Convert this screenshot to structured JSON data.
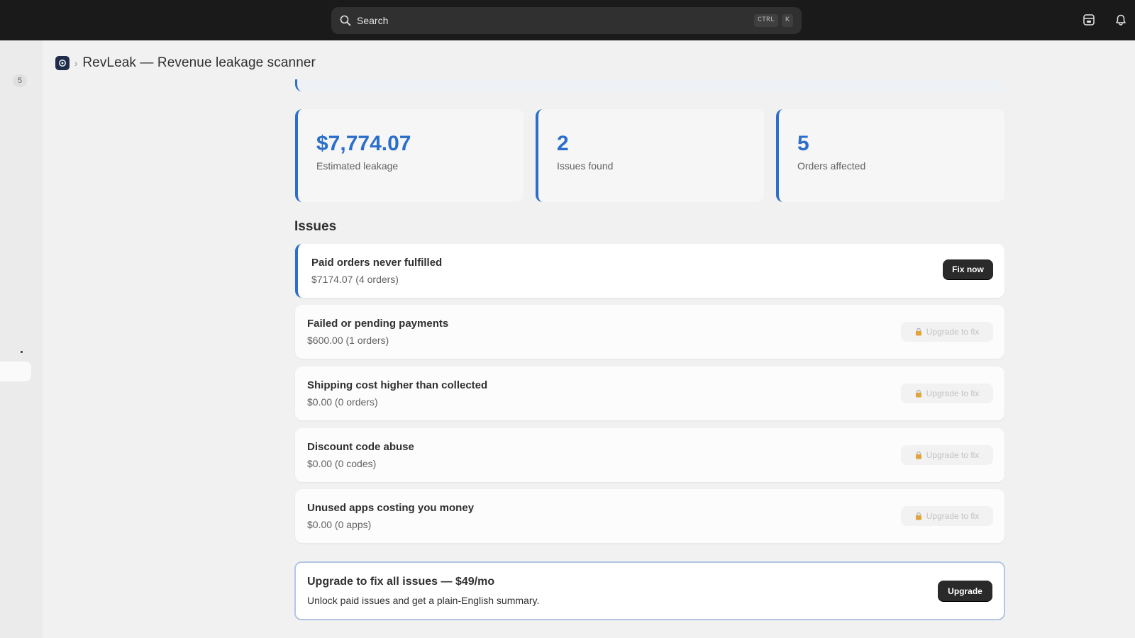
{
  "topbar": {
    "search_label": "Search",
    "shortcut_modifier": "CTRL",
    "shortcut_key": "K"
  },
  "sidebar": {
    "badge": "5"
  },
  "breadcrumb": {
    "app_title": "RevLeak — Revenue leakage scanner"
  },
  "stats": [
    {
      "value": "$7,774.07",
      "label": "Estimated leakage"
    },
    {
      "value": "2",
      "label": "Issues found"
    },
    {
      "value": "5",
      "label": "Orders affected"
    }
  ],
  "issues_section": {
    "title": "Issues",
    "items": [
      {
        "title": "Paid orders never fulfilled",
        "subtitle": "$7174.07 (4 orders)",
        "action": "Fix now"
      },
      {
        "title": "Failed or pending payments",
        "subtitle": "$600.00 (1 orders)",
        "action": "Upgrade to fix"
      },
      {
        "title": "Shipping cost higher than collected",
        "subtitle": "$0.00 (0 orders)",
        "action": "Upgrade to fix"
      },
      {
        "title": "Discount code abuse",
        "subtitle": "$0.00 (0 codes)",
        "action": "Upgrade to fix"
      },
      {
        "title": "Unused apps costing you money",
        "subtitle": "$0.00 (0 apps)",
        "action": "Upgrade to fix"
      }
    ]
  },
  "upgrade": {
    "title": "Upgrade to fix all issues — $49/mo",
    "subtitle": "Unlock paid issues and get a plain-English summary.",
    "button": "Upgrade"
  },
  "colors": {
    "accent": "#2c6ecb",
    "topbar": "#1a1a1a",
    "background": "#f1f1f1",
    "button_dark": "#2a2a2a"
  },
  "icons": {
    "search": "search-icon",
    "store": "store-icon",
    "notifications": "bell-icon",
    "app": "revleak-app-icon",
    "locked": "lock-icon"
  }
}
